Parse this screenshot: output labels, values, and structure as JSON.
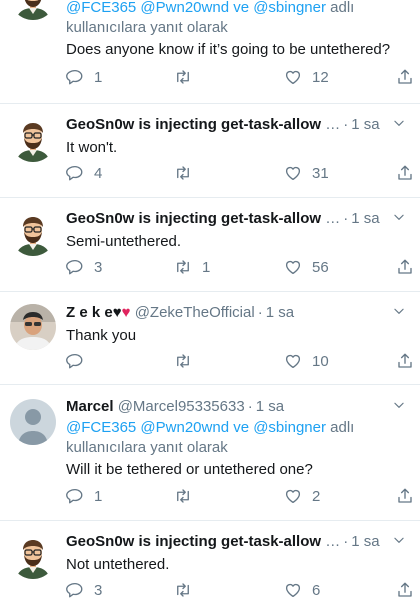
{
  "tweets": [
    {
      "reply_to_prefix": "",
      "reply_links": "@FCE365 @Pwn20wnd ve @sbingner",
      "reply_suffix": " adlı kullanıcılara yanıt olarak",
      "text": "Does anyone know if it’s going to be untethered?",
      "reply_count": "1",
      "retweet_count": "",
      "like_count": "12"
    },
    {
      "name": "GeoSn0w is injecting get-task-allow",
      "handle": "…",
      "dot": "·",
      "time": "1 sa",
      "text": "It won't.",
      "reply_count": "4",
      "retweet_count": "",
      "like_count": "31"
    },
    {
      "name": "GeoSn0w is injecting get-task-allow",
      "handle": "…",
      "dot": "·",
      "time": "1 sa",
      "text": "Semi-untethered.",
      "reply_count": "3",
      "retweet_count": "1",
      "like_count": "56"
    },
    {
      "name": "Z e k e",
      "handle": "@ZekeTheOfficial",
      "dot": "·",
      "time": "1 sa",
      "text": "Thank you",
      "reply_count": "",
      "retweet_count": "",
      "like_count": "10"
    },
    {
      "name": "Marcel",
      "handle": "@Marcel95335633",
      "dot": "·",
      "time": "1 sa",
      "reply_links": "@FCE365 @Pwn20wnd ve @sbingner",
      "reply_suffix": " adlı kullanıcılara yanıt olarak",
      "text": "Will it be tethered or untethered one?",
      "reply_count": "1",
      "retweet_count": "",
      "like_count": "2"
    },
    {
      "name": "GeoSn0w is injecting get-task-allow",
      "handle": "…",
      "dot": "·",
      "time": "1 sa",
      "text": "Not untethered.",
      "reply_count": "3",
      "retweet_count": "",
      "like_count": "6"
    }
  ],
  "colors": {
    "link": "#1da1f2",
    "muted": "#657786",
    "text": "#14171a",
    "heart_emoji": "#e0245e"
  },
  "icons": [
    "reply-icon",
    "retweet-icon",
    "like-icon",
    "share-icon",
    "chevron-down-icon",
    "black-heart-emoji",
    "broken-heart-emoji"
  ]
}
